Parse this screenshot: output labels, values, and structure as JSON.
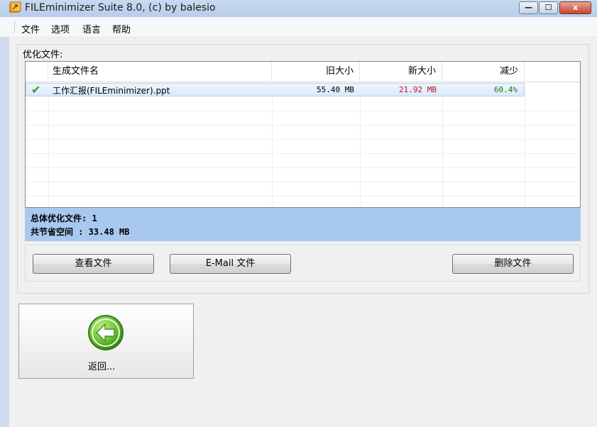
{
  "window": {
    "title": "FILEminimizer Suite 8.0, (c) by balesio",
    "min_glyph": "—",
    "max_glyph": "☐",
    "close_glyph": "x"
  },
  "menu": {
    "items": [
      "文件",
      "选项",
      "语言",
      "帮助"
    ]
  },
  "group": {
    "label": "优化文件:"
  },
  "table": {
    "columns": [
      "生成文件名",
      "旧大小",
      "新大小",
      "减少"
    ],
    "rows": [
      {
        "status": "✔",
        "name": "工作汇报(FILEminimizer).ppt",
        "old_size": "55.40 MB",
        "new_size": "21.92 MB",
        "reduction": "60.4%"
      }
    ]
  },
  "summary": {
    "total_files": "总体优化文件: 1",
    "saved_space": "共节省空间  : 33.48 MB"
  },
  "buttons": {
    "view": "查看文件",
    "email": "E-Mail 文件",
    "delete": "删除文件"
  },
  "back": {
    "label": "返回..."
  },
  "colors": {
    "new_size": "#c0102a",
    "reduction": "#1a7a1a",
    "summary_bg": "#a9c8ef",
    "check": "#3c9a2e"
  }
}
